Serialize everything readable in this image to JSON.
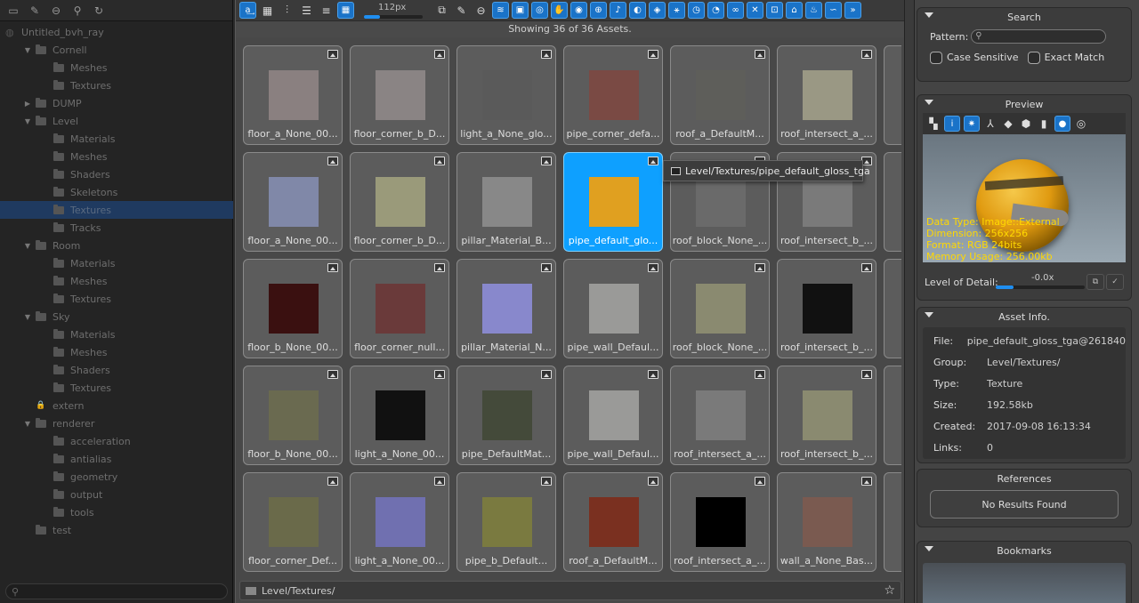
{
  "tree": {
    "root": "Untitled_bvh_ray",
    "nodes": [
      {
        "label": "Cornell",
        "depth": 1,
        "arrow": "▼"
      },
      {
        "label": "Meshes",
        "depth": 2,
        "arrow": ""
      },
      {
        "label": "Textures",
        "depth": 2,
        "arrow": ""
      },
      {
        "label": "DUMP",
        "depth": 1,
        "arrow": "▶"
      },
      {
        "label": "Level",
        "depth": 1,
        "arrow": "▼"
      },
      {
        "label": "Materials",
        "depth": 2,
        "arrow": ""
      },
      {
        "label": "Meshes",
        "depth": 2,
        "arrow": ""
      },
      {
        "label": "Shaders",
        "depth": 2,
        "arrow": ""
      },
      {
        "label": "Skeletons",
        "depth": 2,
        "arrow": ""
      },
      {
        "label": "Textures",
        "depth": 2,
        "arrow": "",
        "selected": true
      },
      {
        "label": "Tracks",
        "depth": 2,
        "arrow": ""
      },
      {
        "label": "Room",
        "depth": 1,
        "arrow": "▼"
      },
      {
        "label": "Materials",
        "depth": 2,
        "arrow": ""
      },
      {
        "label": "Meshes",
        "depth": 2,
        "arrow": ""
      },
      {
        "label": "Textures",
        "depth": 2,
        "arrow": ""
      },
      {
        "label": "Sky",
        "depth": 1,
        "arrow": "▼"
      },
      {
        "label": "Materials",
        "depth": 2,
        "arrow": ""
      },
      {
        "label": "Meshes",
        "depth": 2,
        "arrow": ""
      },
      {
        "label": "Shaders",
        "depth": 2,
        "arrow": ""
      },
      {
        "label": "Textures",
        "depth": 2,
        "arrow": ""
      },
      {
        "label": "extern",
        "depth": 1,
        "arrow": "",
        "lock": true
      },
      {
        "label": "renderer",
        "depth": 1,
        "arrow": "▼"
      },
      {
        "label": "acceleration",
        "depth": 2,
        "arrow": ""
      },
      {
        "label": "antialias",
        "depth": 2,
        "arrow": ""
      },
      {
        "label": "geometry",
        "depth": 2,
        "arrow": ""
      },
      {
        "label": "output",
        "depth": 2,
        "arrow": ""
      },
      {
        "label": "tools",
        "depth": 2,
        "arrow": ""
      },
      {
        "label": "test",
        "depth": 1,
        "arrow": ""
      }
    ]
  },
  "toolbar": {
    "zoom_label": "112px"
  },
  "status": "Showing 36 of 36 Assets.",
  "assets": [
    [
      "floor_a_None_00...",
      "floor_corner_b_D...",
      "light_a_None_glo...",
      "pipe_corner_defa...",
      "roof_a_DefaultM...",
      "roof_intersect_a_...",
      "wa"
    ],
    [
      "floor_a_None_00...",
      "floor_corner_b_D...",
      "pillar_Material_B...",
      "pipe_default_glo...",
      "roof_block_None_...",
      "roof_intersect_b_...",
      "wa"
    ],
    [
      "floor_b_None_00...",
      "floor_corner_null...",
      "pillar_Material_N...",
      "pipe_wall_Defaul...",
      "roof_block_None_...",
      "roof_intersect_b_...",
      "wa"
    ],
    [
      "floor_b_None_00...",
      "light_a_None_00...",
      "pipe_DefaultMat...",
      "pipe_wall_Defaul...",
      "roof_intersect_a_...",
      "roof_intersect_b_...",
      "wa"
    ],
    [
      "floor_corner_Def...",
      "light_a_None_00...",
      "pipe_b_Default...",
      "roof_a_DefaultM...",
      "roof_intersect_a_...",
      "wall_a_None_Bas...",
      "wa"
    ]
  ],
  "selected_asset": {
    "row": 1,
    "col": 3
  },
  "tooltip": "Level/Textures/pipe_default_gloss_tga",
  "path_bar": "Level/Textures/",
  "search": {
    "title": "Search",
    "pattern_label": "Pattern:",
    "case_sensitive": "Case Sensitive",
    "exact_match": "Exact Match"
  },
  "preview": {
    "title": "Preview",
    "data_type": "Data Type: Image::External",
    "dimension": "Dimension: 256x256",
    "format": "Format: RGB 24bits",
    "memory": "Memory Usage: 256.00kb",
    "lod_label": "Level of Detail:",
    "lod_value": "-0.0x"
  },
  "asset_info": {
    "title": "Asset Info.",
    "rows": [
      {
        "k": "File:",
        "v": "pipe_default_gloss_tga@261840"
      },
      {
        "k": "Group:",
        "v": "Level/Textures/"
      },
      {
        "k": "Type:",
        "v": "Texture"
      },
      {
        "k": "Size:",
        "v": "192.58kb"
      },
      {
        "k": "Created:",
        "v": "2017-09-08 16:13:34"
      },
      {
        "k": "Links:",
        "v": "0"
      }
    ]
  },
  "references": {
    "title": "References",
    "empty": "No Results Found"
  },
  "bookmarks": {
    "title": "Bookmarks"
  },
  "colors": {
    "accent": "#1f8ef0",
    "selection": "#0ea0ff",
    "info_text": "#ffd800"
  }
}
